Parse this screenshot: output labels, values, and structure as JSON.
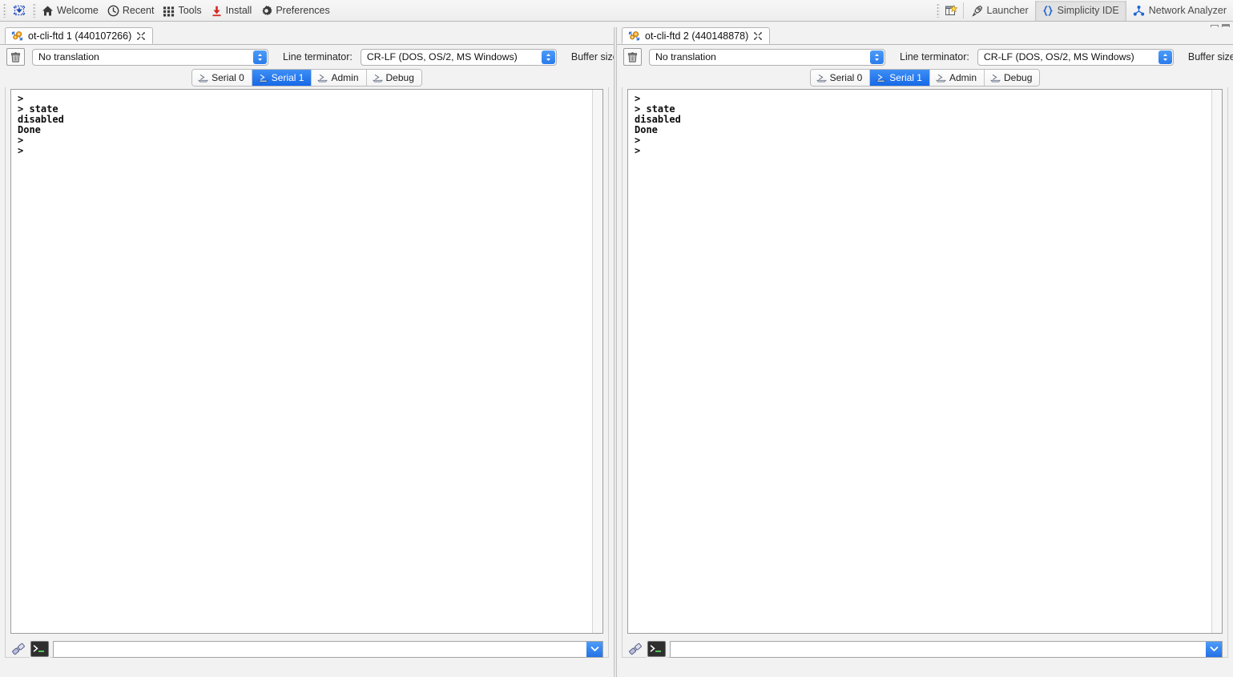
{
  "toolbar": {
    "chip_icon": "chip-download-icon",
    "items": [
      {
        "label": "Welcome",
        "icon": "home-icon"
      },
      {
        "label": "Recent",
        "icon": "clock-icon"
      },
      {
        "label": "Tools",
        "icon": "grid-icon"
      },
      {
        "label": "Install",
        "icon": "download-icon"
      },
      {
        "label": "Preferences",
        "icon": "gear-icon"
      }
    ],
    "perspective_button_icon": "open-perspective-icon",
    "perspectives": [
      {
        "label": "Launcher",
        "icon": "rocket-icon",
        "active": false
      },
      {
        "label": "Simplicity IDE",
        "icon": "braces-icon",
        "active": true
      },
      {
        "label": "Network Analyzer",
        "icon": "network-icon",
        "active": false
      }
    ]
  },
  "view_controls": {
    "minimize_icon": "minimize-icon",
    "maximize_icon": "maximize-icon"
  },
  "colors": {
    "accent_blue": "#2a7cec",
    "tab_active_blue": "#1769e8",
    "toolbar_bg": "#ededed",
    "panel_bg": "#f2f2f2",
    "console_bg": "#ffffff",
    "console_text": "#0b0b0b"
  },
  "common": {
    "translation_label": "No translation",
    "line_terminator_label": "Line terminator:",
    "line_terminator_value": "CR-LF  (DOS, OS/2, MS Windows)",
    "buffer_size_label": "Buffer size",
    "clear_icon": "trash-icon",
    "close_icon": "close-x-icon",
    "editor_tab_icon": "serial-console-icon",
    "plug_icon": "plug-disconnect-icon",
    "terminal_icon": "terminal-prompt-icon",
    "dropdown_icon": "chevron-down-icon",
    "stepper_icon": "stepper-up-down-icon",
    "command_placeholder": "",
    "command_value": "",
    "serial_tabs": [
      {
        "label": "Serial 0",
        "icon": "keyboard-icon",
        "active": false
      },
      {
        "label": "Serial 1",
        "icon": "keyboard-icon",
        "active": true
      },
      {
        "label": "Admin",
        "icon": "keyboard-icon",
        "active": false
      },
      {
        "label": "Debug",
        "icon": "keyboard-icon",
        "active": false
      }
    ],
    "console_output": ">\n> state\ndisabled\nDone\n>\n>"
  },
  "panels": [
    {
      "tab_title": "ot-cli-ftd 1 (440107266)",
      "device_name": "ot-cli-ftd 1",
      "device_id": "440107266"
    },
    {
      "tab_title": "ot-cli-ftd 2 (440148878)",
      "device_name": "ot-cli-ftd 2",
      "device_id": "440148878"
    }
  ]
}
